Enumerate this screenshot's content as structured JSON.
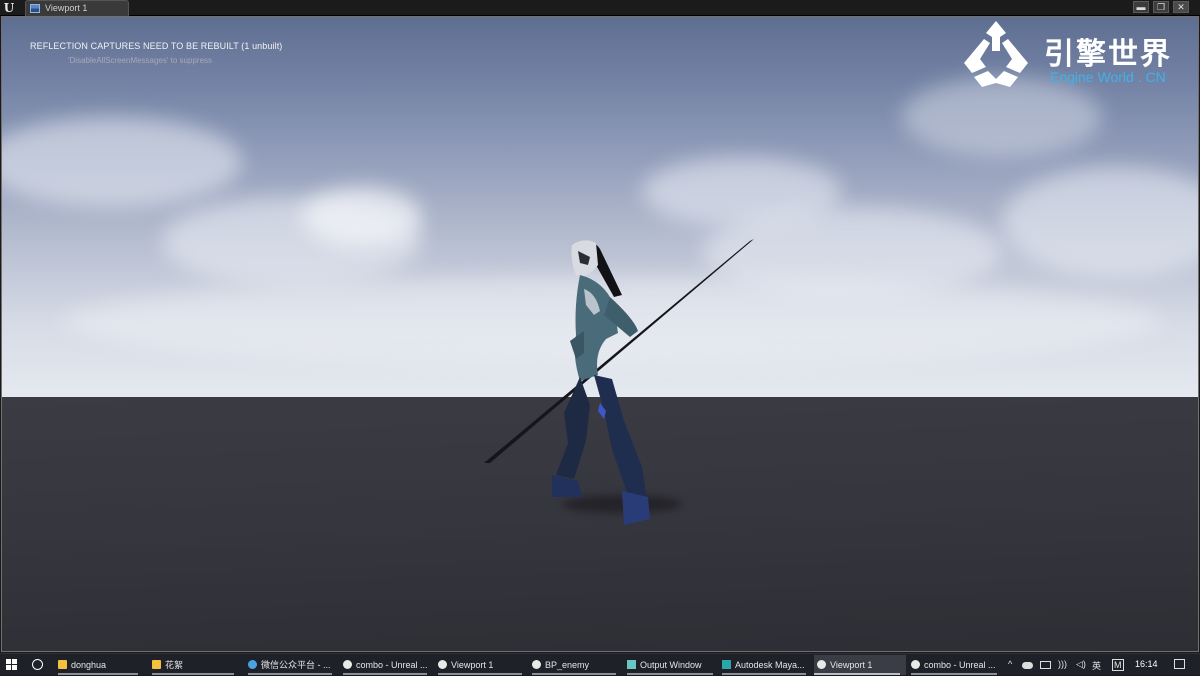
{
  "window": {
    "logo": "U",
    "tab_label": "Viewport 1",
    "controls": {
      "minimize": "▬",
      "maximize": "❐",
      "close": "✕"
    }
  },
  "viewport": {
    "warning": "REFLECTION CAPTURES NEED TO BE REBUILT (1 unbuilt)",
    "warning_hint": "'DisableAllScreenMessages' to suppress"
  },
  "watermark": {
    "title": "引擎世界",
    "subtitle": "Engine World . CN"
  },
  "taskbar": {
    "items": [
      {
        "label": "donghua",
        "icon": "folder-icon",
        "active": false
      },
      {
        "label": "花絮",
        "icon": "folder-icon",
        "active": false
      },
      {
        "label": "微信公众平台 - ...",
        "icon": "browser-icon",
        "active": false
      },
      {
        "label": "combo - Unreal ...",
        "icon": "unreal-icon",
        "active": false
      },
      {
        "label": "Viewport 1",
        "icon": "unreal-icon",
        "active": false
      },
      {
        "label": "BP_enemy",
        "icon": "unreal-icon",
        "active": false
      },
      {
        "label": "Output Window",
        "icon": "output-window-icon",
        "active": false
      },
      {
        "label": "Autodesk Maya...",
        "icon": "maya-icon",
        "active": false
      },
      {
        "label": "Viewport 1",
        "icon": "unreal-icon",
        "active": true
      },
      {
        "label": "combo - Unreal ...",
        "icon": "unreal-icon",
        "active": false
      }
    ],
    "tray": {
      "ime": "英",
      "ime_mode": "M",
      "clock": "16:14"
    }
  },
  "colors": {
    "watermark_subtitle": "#3fb3e8",
    "ground": "#36363e",
    "sky_top": "#5e6e91",
    "sky_horizon": "#e6eaf0"
  }
}
